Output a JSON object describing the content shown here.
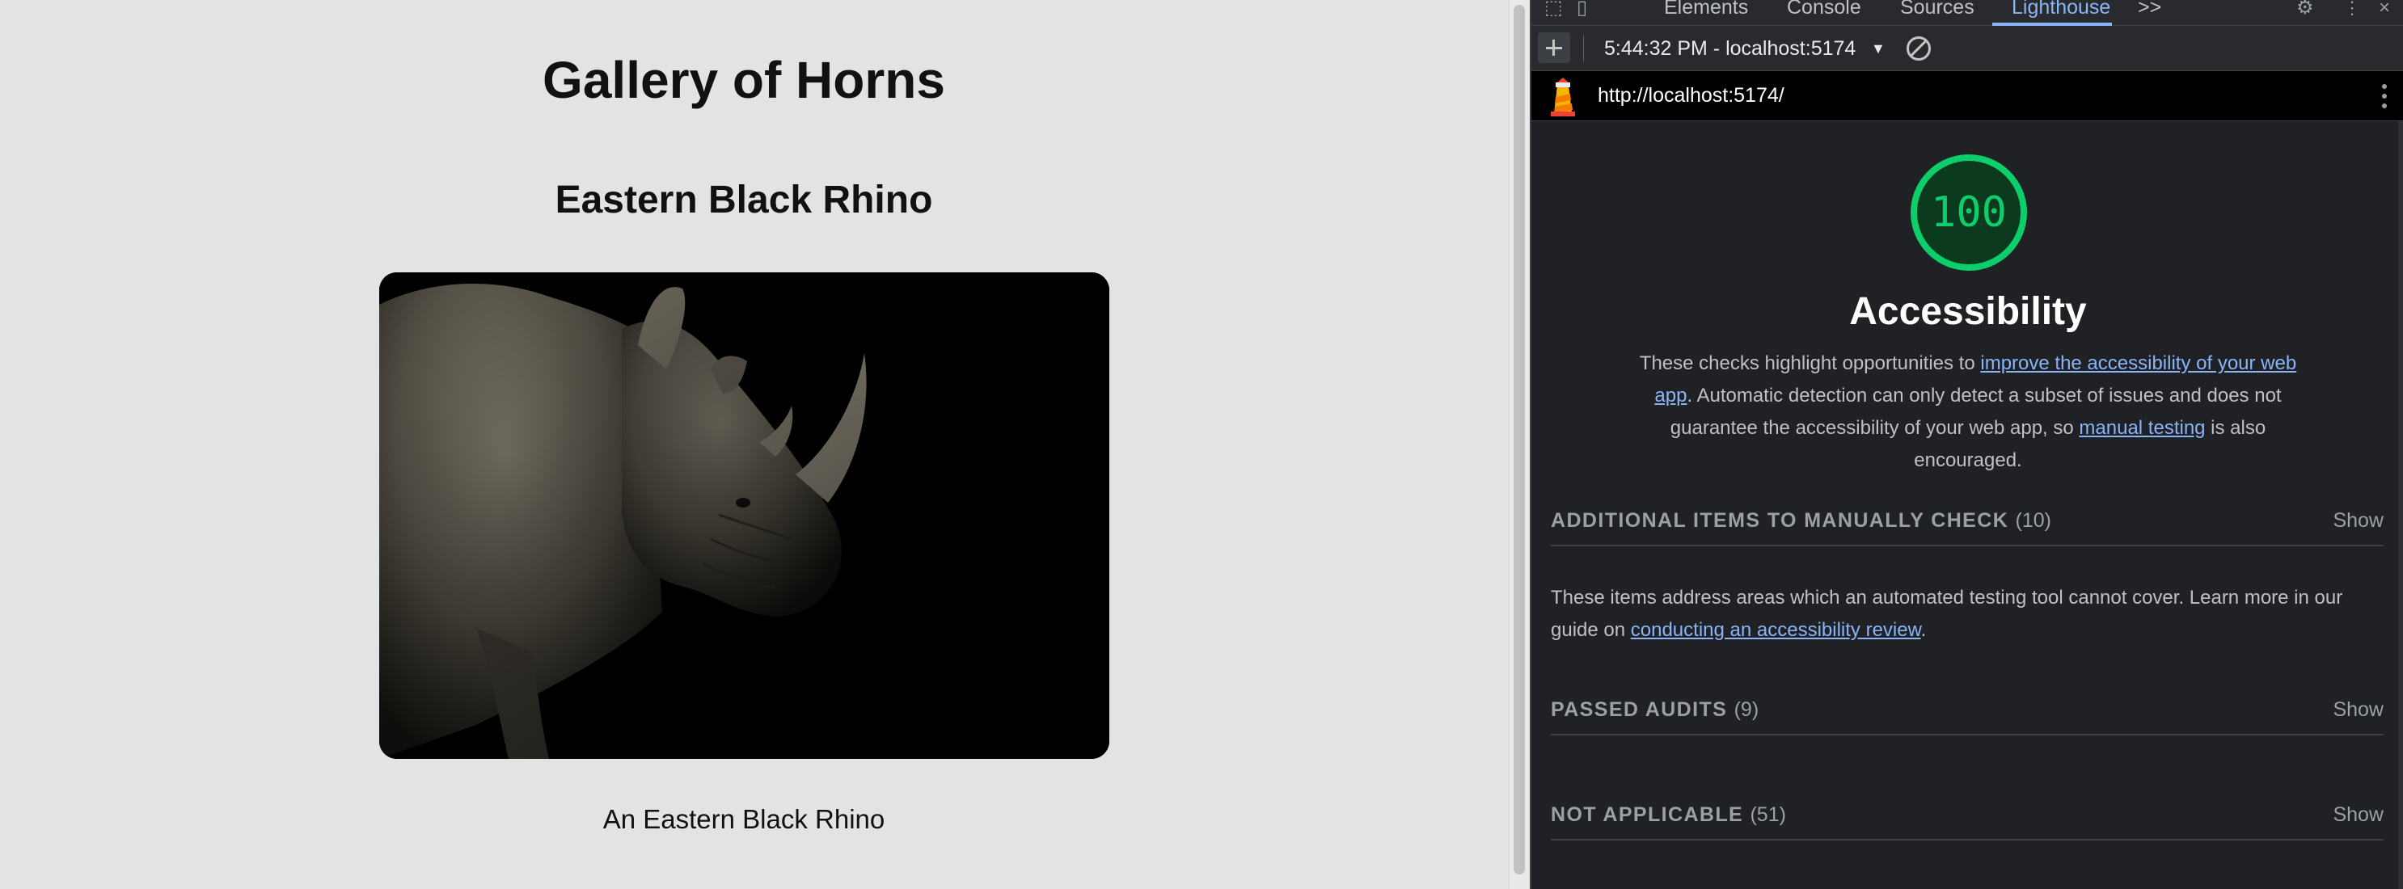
{
  "page": {
    "title": "Gallery of Horns",
    "card_title": "Eastern Black Rhino",
    "image_alt": "An Eastern Black Rhino",
    "caption": "An Eastern Black Rhino"
  },
  "devtools": {
    "tabs": [
      {
        "label": "Elements"
      },
      {
        "label": "Console"
      },
      {
        "label": "Sources"
      },
      {
        "label": "Lighthouse",
        "active": true
      }
    ],
    "more_tabs_symbol": ">>",
    "report_selector": "5:44:32 PM - localhost:5174",
    "url": "http://localhost:5174/",
    "score": "100",
    "score_color": "#0cce6b",
    "category": "Accessibility",
    "description": {
      "part1": "These checks highlight opportunities to ",
      "link1": "improve the accessibility of your web app",
      "part2": ". Automatic detection can only detect a subset of issues and does not guarantee the accessibility of your web app, so ",
      "link2": "manual testing",
      "part3": " is also encouraged."
    },
    "groups": [
      {
        "title": "ADDITIONAL ITEMS TO MANUALLY CHECK",
        "count": "(10)",
        "action": "Show"
      },
      {
        "title": "PASSED AUDITS",
        "count": "(9)",
        "action": "Show"
      },
      {
        "title": "NOT APPLICABLE",
        "count": "(51)",
        "action": "Show"
      }
    ],
    "manual_description": {
      "text": "These items address areas which an automated testing tool cannot cover. Learn more in our guide on ",
      "link": "conducting an accessibility review",
      "end": "."
    },
    "icons": [
      "inspect-icon",
      "device-toggle-icon",
      "settings-icon",
      "more-options-icon",
      "close-icon",
      "add-report-icon",
      "clear-icon",
      "lighthouse-logo-icon",
      "kebab-menu-icon"
    ]
  }
}
